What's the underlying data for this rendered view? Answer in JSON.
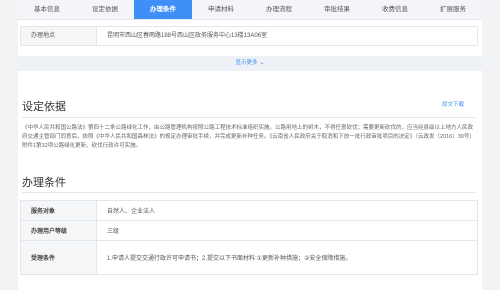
{
  "tabs": [
    {
      "label": "基本信息"
    },
    {
      "label": "设定依据"
    },
    {
      "label": "办理条件"
    },
    {
      "label": "申请材料"
    },
    {
      "label": "办理流程"
    },
    {
      "label": "审批结果"
    },
    {
      "label": "收费信息"
    },
    {
      "label": "扩展服务"
    }
  ],
  "active_tab_index": 2,
  "address": {
    "label": "办理地点",
    "value": "昆明市西山区春雨路188号西山区政务服务中心13楼13A06室"
  },
  "show_more": {
    "label": "显示更多"
  },
  "basis": {
    "title": "设定依据",
    "download_label": "原文下载",
    "text": "《中华人民共和国公路法》第四十二条公路绿化工作，由公路管理机构按照公路工程技术标准组织实施。公路用地上的树木，不得任意砍伐；需要更新砍伐的，应当经县级以上地方人民政府交通主管部门同意后，依照《中华人民共和国森林法》的规定办理审批手续，并完成更新补种任务。《云南省人民政府关于取消和下放一批行政审批项目的决定》（云政发〔2016〕39号）附件1第32项公路绿化更新、砍伐行政许可实施。"
  },
  "conditions": {
    "title": "办理条件",
    "rows": [
      {
        "label": "服务对象",
        "value": "自然人、企业法人"
      },
      {
        "label": "办理用户等级",
        "value": "三级"
      },
      {
        "label": "受理条件",
        "value": "1.申请人提交交通行政许可申请书；2.提交以下书面材料:①更新补种措施；②安全保障措施。"
      }
    ]
  },
  "colors": {
    "accent": "#3e8ff7",
    "tab_bg": "#f3f5f8",
    "label_bg": "#f5f6f8",
    "border": "#e3e6ea"
  }
}
